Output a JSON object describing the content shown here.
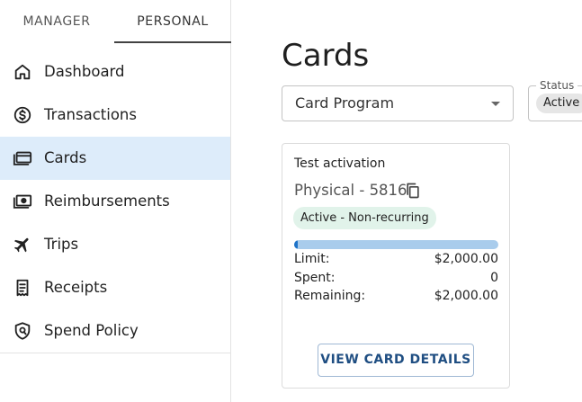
{
  "sidebar": {
    "tabs": [
      {
        "label": "MANAGER",
        "selected": false
      },
      {
        "label": "PERSONAL",
        "selected": true
      }
    ],
    "items": [
      {
        "label": "Dashboard",
        "icon": "home-icon",
        "selected": false
      },
      {
        "label": "Transactions",
        "icon": "dollar-circle-icon",
        "selected": false
      },
      {
        "label": "Cards",
        "icon": "credit-card-icon",
        "selected": true
      },
      {
        "label": "Reimbursements",
        "icon": "cash-icon",
        "selected": false
      },
      {
        "label": "Trips",
        "icon": "airplane-icon",
        "selected": false
      },
      {
        "label": "Receipts",
        "icon": "receipt-icon",
        "selected": false
      },
      {
        "label": "Spend Policy",
        "icon": "shield-icon",
        "selected": false
      }
    ]
  },
  "main": {
    "title": "Cards",
    "filters": {
      "card_program": {
        "value": "Card Program"
      },
      "status": {
        "legend": "Status",
        "chip": "Active"
      }
    },
    "cards": [
      {
        "name": "Test activation",
        "number": "Physical - 5816",
        "status": "Active - Non-recurring",
        "spent_fraction": 0,
        "limit_label": "Limit:",
        "limit_value": "$2,000.00",
        "spent_label": "Spent:",
        "spent_value": "0",
        "remaining_label": "Remaining:",
        "remaining_value": "$2,000.00",
        "button_label": "VIEW CARD DETAILS"
      }
    ]
  },
  "colors": {
    "selected_nav_bg": "#ddecfa",
    "progress_track": "#a9ccec",
    "progress_fill": "#1e73c8",
    "status_badge_bg": "#e1f3ea",
    "button_text": "#1f4e82"
  }
}
